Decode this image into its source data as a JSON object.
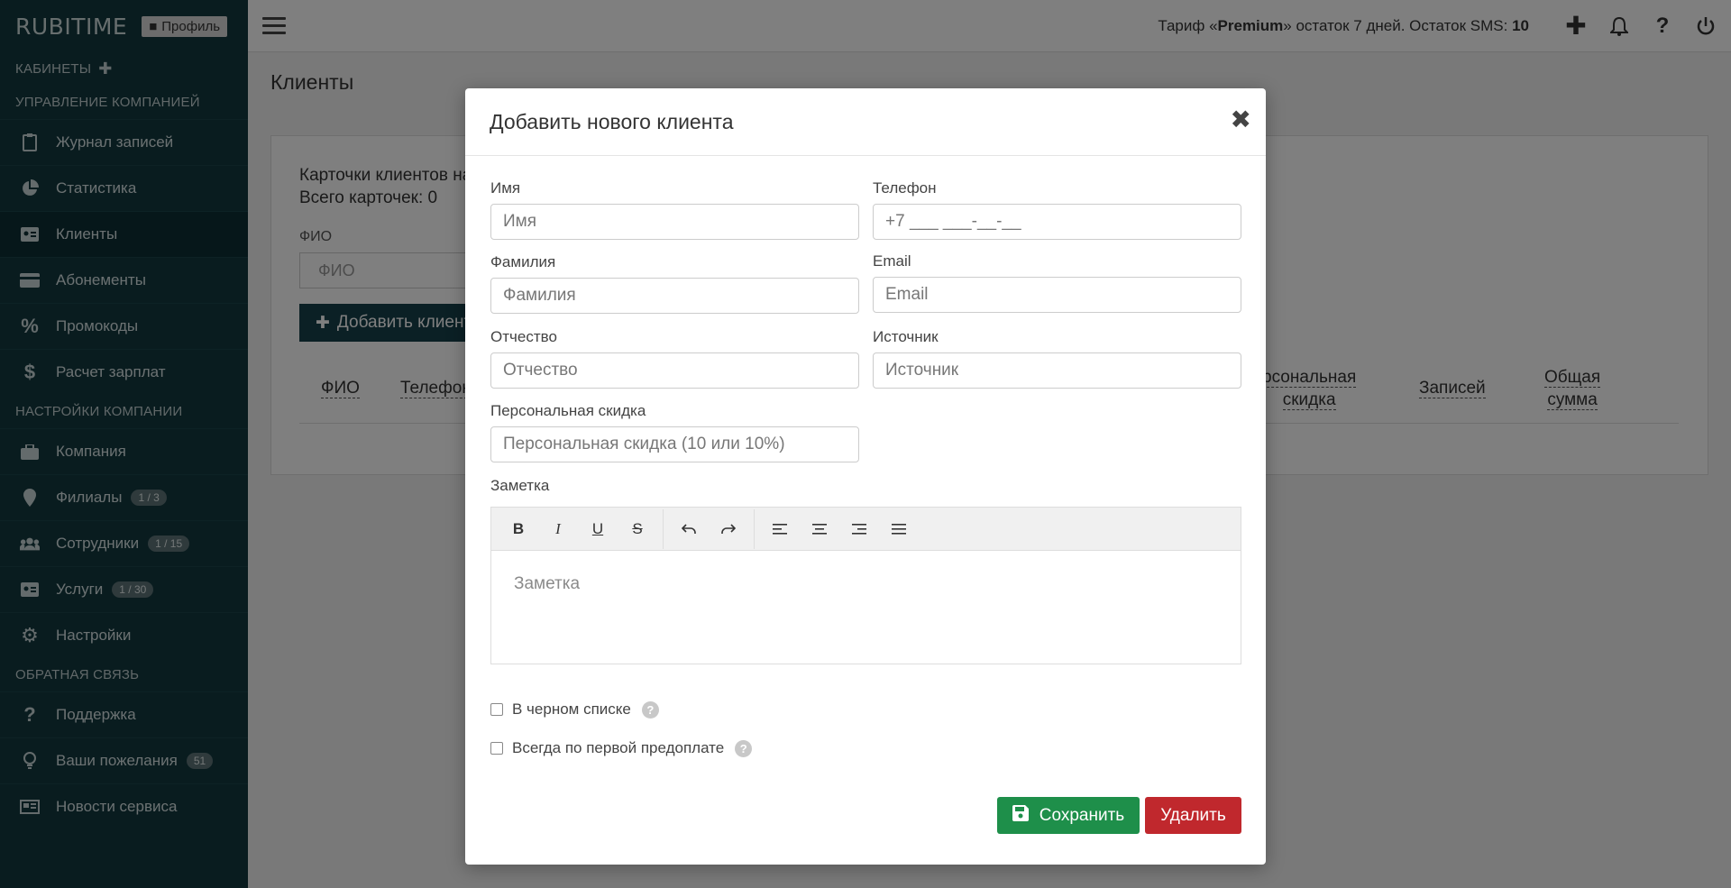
{
  "brand": "RUBITIME",
  "profile_label": "Профиль",
  "sidebar": {
    "sections": {
      "cabinets": "КАБИНЕТЫ",
      "management": "УПРАВЛЕНИЕ КОМПАНИЕЙ",
      "settings": "НАСТРОЙКИ КОМПАНИИ",
      "feedback": "ОБРАТНАЯ СВЯЗЬ"
    },
    "items": {
      "journal": "Журнал записей",
      "stats": "Статистика",
      "clients": "Клиенты",
      "subscriptions": "Абонементы",
      "promocodes": "Промокоды",
      "salary": "Расчет зарплат",
      "company": "Компания",
      "branches": "Филиалы",
      "branches_badge": "1 / 3",
      "staff": "Сотрудники",
      "staff_badge": "1 / 15",
      "services": "Услуги",
      "services_badge": "1 / 30",
      "settings": "Настройки",
      "support": "Поддержка",
      "wishes": "Ваши пожелания",
      "wishes_badge": "51",
      "news": "Новости сервиса"
    }
  },
  "topbar": {
    "tariff_prefix": "Тариф «",
    "tariff_name": "Premium",
    "tariff_middle": "» остаток 7 дней. Остаток SMS: ",
    "sms_count": "10"
  },
  "page": {
    "title": "Клиенты",
    "cards_line1": "Карточки клиентов на",
    "cards_line2": "Всего карточек: 0",
    "fio_label": "ФИО",
    "fio_placeholder": "ФИО",
    "add_client": "Добавить клиент",
    "columns": {
      "fio": "ФИО",
      "phone": "Телефон",
      "discount_1": "рсональная",
      "discount_2": "скидка",
      "records": "Записей",
      "total_1": "Общая",
      "total_2": "сумма"
    }
  },
  "modal": {
    "title": "Добавить нового клиента",
    "close": "✖",
    "fields": {
      "name_label": "Имя",
      "name_placeholder": "Имя",
      "phone_label": "Телефон",
      "phone_placeholder": "+7 ___ ___-__-__",
      "surname_label": "Фамилия",
      "surname_placeholder": "Фамилия",
      "email_label": "Email",
      "email_placeholder": "Email",
      "patronymic_label": "Отчество",
      "patronymic_placeholder": "Отчество",
      "source_label": "Источник",
      "source_placeholder": "Источник",
      "discount_label": "Персональная скидка",
      "discount_placeholder": "Персональная скидка (10 или 10%)",
      "note_label": "Заметка",
      "note_placeholder": "Заметка"
    },
    "checkboxes": {
      "blacklist": "В черном списке",
      "prepay": "Всегда по первой предоплате"
    },
    "buttons": {
      "save": "Сохранить",
      "delete": "Удалить"
    }
  },
  "colors": {
    "sidebar_bg": "#12393f",
    "save_green": "#1e8f4a",
    "delete_red": "#c0282d"
  }
}
